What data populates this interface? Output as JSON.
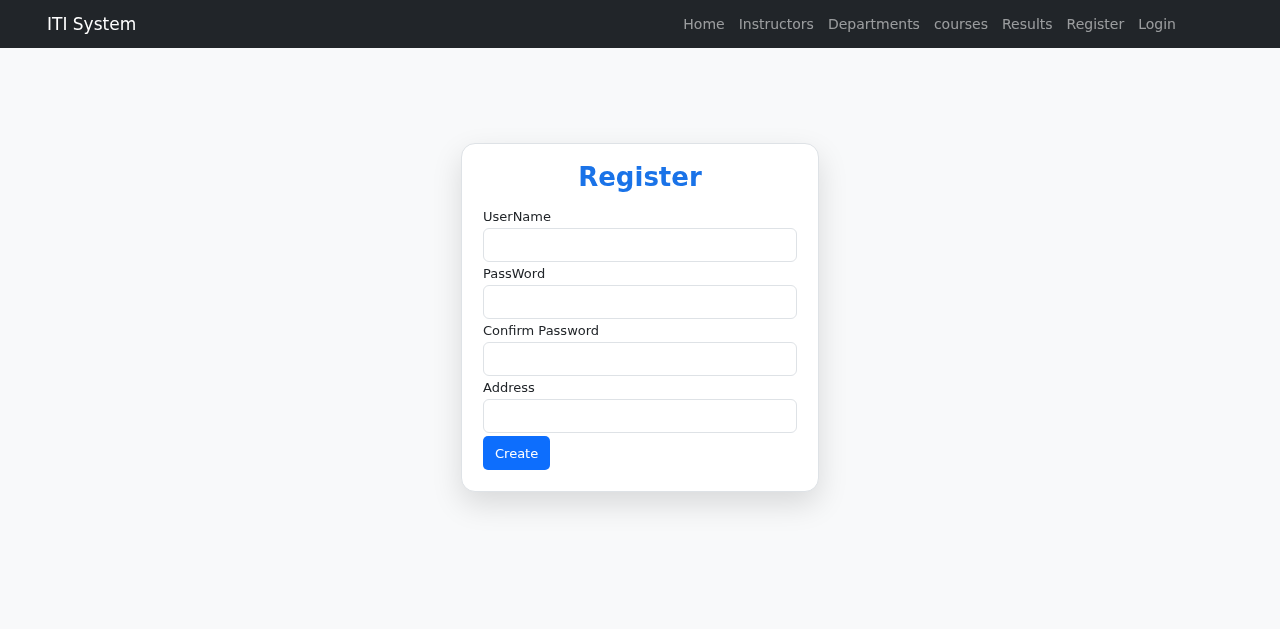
{
  "navbar": {
    "brand": "ITI System",
    "links": [
      "Home",
      "Instructors",
      "Departments",
      "courses",
      "Results",
      "Register",
      "Login"
    ]
  },
  "form": {
    "title": "Register",
    "fields": [
      {
        "label": "UserName"
      },
      {
        "label": "PassWord"
      },
      {
        "label": "Confirm Password"
      },
      {
        "label": "Address"
      }
    ],
    "submit": "Create"
  }
}
